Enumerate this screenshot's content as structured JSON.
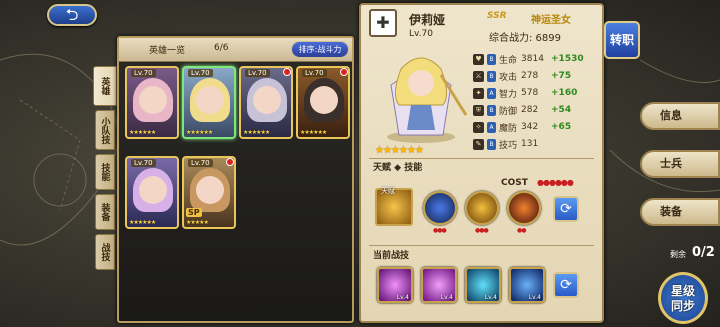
{
  "nav": {
    "back_symbol": "⮌"
  },
  "hero_list": {
    "title": "英雄一览",
    "count": "6/6",
    "sort_label": "排序:战斗力",
    "side_tabs": [
      "英雄",
      "小队技",
      "技能",
      "装备",
      "战技"
    ],
    "cards": [
      {
        "level": "Lv.70",
        "stars": "★★★★★★",
        "hair": "#e9b6c8",
        "selected": false
      },
      {
        "level": "Lv.70",
        "stars": "★★★★★★",
        "hair": "#f0dc8c",
        "selected": true
      },
      {
        "level": "Lv.70",
        "stars": "★★★★★★",
        "hair": "#c8c2d8",
        "selected": false
      },
      {
        "level": "Lv.70",
        "stars": "★★★★★★",
        "hair": "#3a2f2a",
        "selected": false
      },
      {
        "level": "Lv.70",
        "stars": "★★★★★★",
        "hair": "#d6b0e6",
        "selected": false
      },
      {
        "level": "Lv.70",
        "stars": "★★★★★",
        "hair": "#c89860",
        "selected": false,
        "sp": "SP"
      }
    ]
  },
  "hero": {
    "class_symbol": "✚",
    "name": "伊莉娅",
    "level": "Lv.70",
    "rarity": "SSR",
    "title": "神运圣女",
    "power": "综合战力: 6899",
    "stars": "★★★★★★",
    "stats": [
      {
        "icon": "♥",
        "name": "生命",
        "value": "3814",
        "bonus": "+1530"
      },
      {
        "icon": "⚔",
        "name": "攻击",
        "value": "278",
        "bonus": "+75"
      },
      {
        "icon": "✦",
        "name": "智力",
        "value": "578",
        "bonus": "+160"
      },
      {
        "icon": "⛨",
        "name": "防御",
        "value": "282",
        "bonus": "+54"
      },
      {
        "icon": "✧",
        "name": "魔防",
        "value": "342",
        "bonus": "+65"
      },
      {
        "icon": "✎",
        "name": "技巧",
        "value": "131",
        "bonus": ""
      }
    ]
  },
  "talent_section": {
    "title": "天赋 ◆ 技能",
    "cost_label": "COST",
    "cost_dots": "●●●●●●",
    "talent_label": "天赋"
  },
  "battle_section": {
    "title": "当前战技",
    "skills": [
      {
        "level": "Lv.4",
        "color": "#c040d8"
      },
      {
        "level": "Lv.4",
        "color": "#d050e0"
      },
      {
        "level": "Lv.4",
        "color": "#30b0d8"
      },
      {
        "level": "Lv.4",
        "color": "#3080e0"
      }
    ]
  },
  "right_menu": {
    "transfer": "转职",
    "info": "信息",
    "soldier": "士兵",
    "equip": "装备",
    "remain_label": "剩余",
    "remain_value": "0/2",
    "sync": "星级\n同步"
  },
  "colors": {
    "accent_gold": "#e8c65a",
    "bonus_green": "#2e8a1e",
    "blue_button": "#2a5ac8"
  }
}
